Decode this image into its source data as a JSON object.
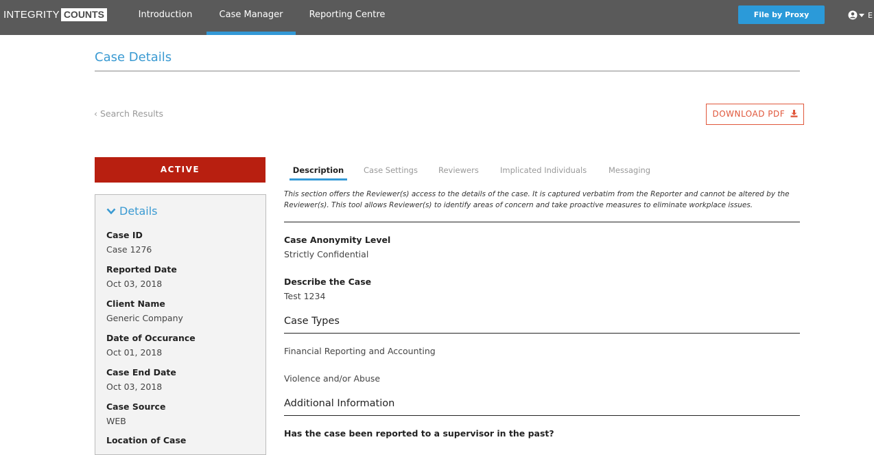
{
  "header": {
    "logo_part1": "INTEGRITY",
    "logo_part2": "COUNTS",
    "nav": [
      {
        "label": "Introduction"
      },
      {
        "label": "Case Manager",
        "active": true
      },
      {
        "label": "Reporting Centre"
      }
    ],
    "proxy_button": "File by Proxy",
    "user_icon": "user-circle-icon",
    "user_truncated": "E",
    "colors": {
      "bar": "#5a5a5a",
      "accent": "#3399d6",
      "button": "#2b9ad9"
    }
  },
  "page": {
    "title": "Case Details",
    "back_link": "Search Results",
    "download_button": "DOWNLOAD PDF",
    "download_icon": "download-icon"
  },
  "sidebar": {
    "status": "ACTIVE",
    "status_color": "#b81f10",
    "details_heading": "Details",
    "fields": [
      {
        "label": "Case ID",
        "value": "Case 1276"
      },
      {
        "label": "Reported Date",
        "value": "Oct 03, 2018"
      },
      {
        "label": "Client Name",
        "value": "Generic Company"
      },
      {
        "label": "Date of Occurance",
        "value": "Oct 01, 2018"
      },
      {
        "label": "Case End Date",
        "value": "Oct 03, 2018"
      },
      {
        "label": "Case Source",
        "value": "WEB"
      },
      {
        "label": "Location of Case",
        "value": ""
      }
    ]
  },
  "tabs": [
    {
      "label": "Description",
      "active": true
    },
    {
      "label": "Case Settings"
    },
    {
      "label": "Reviewers"
    },
    {
      "label": "Implicated Individuals"
    },
    {
      "label": "Messaging"
    }
  ],
  "description": {
    "intro": "This section offers the Reviewer(s) access to the details of the case. It is captured verbatim from the Reporter and cannot be altered by the Reviewer(s). This tool allows Reviewer(s) to identify areas of concern and take proactive measures to eliminate workplace issues.",
    "anonymity_label": "Case Anonymity Level",
    "anonymity_value": "Strictly Confidential",
    "describe_label": "Describe the Case",
    "describe_value": "Test 1234",
    "case_types_heading": "Case Types",
    "case_types": [
      "Financial Reporting and Accounting",
      "Violence and/or Abuse"
    ],
    "additional_heading": "Additional Information",
    "supervisor_question": "Has the case been reported to a supervisor in the past?"
  }
}
